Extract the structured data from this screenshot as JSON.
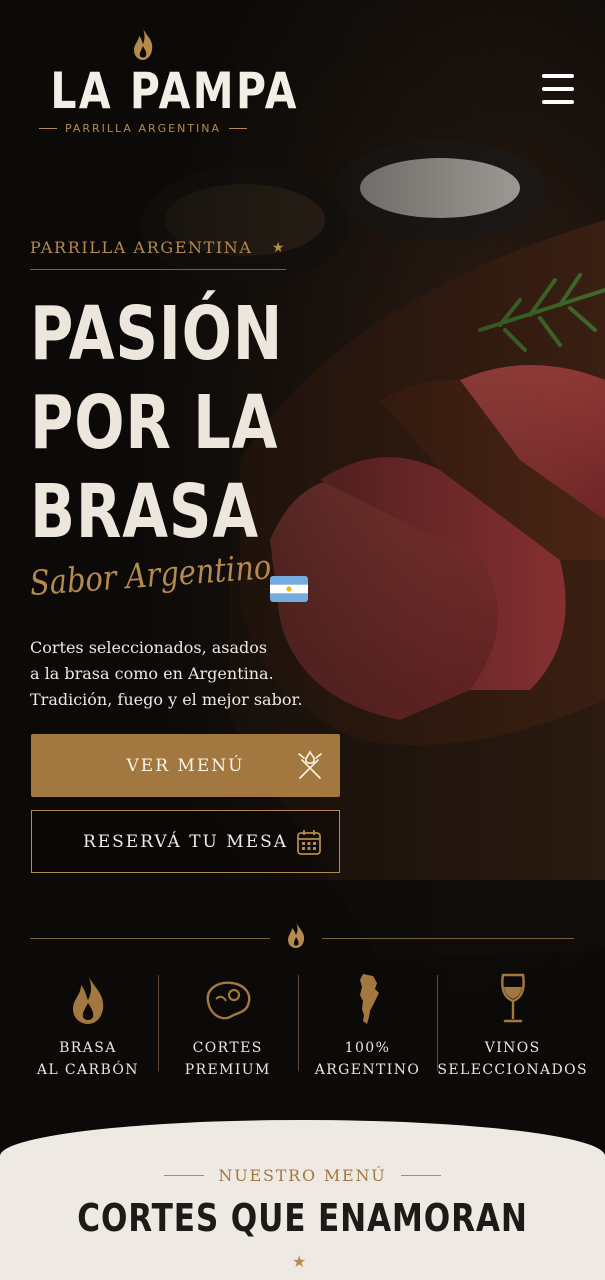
{
  "brand": {
    "name": "LA PAMPA",
    "tagline": "PARRILLA ARGENTINA",
    "accent": "#b58a4e"
  },
  "header": {
    "menu_icon": "hamburger-menu-icon"
  },
  "hero": {
    "eyebrow": "PARRILLA ARGENTINA",
    "title_lines": [
      "PASIÓN",
      "POR LA",
      "BRASA"
    ],
    "script": "Sabor Argentino",
    "description_lines": [
      "Cortes seleccionados, asados",
      "a la brasa como en Argentina.",
      "Tradición, fuego y el mejor sabor."
    ],
    "primary_button": {
      "label": "VER MENÚ",
      "icon": "grill-fork-icon"
    },
    "secondary_button": {
      "label": "RESERVÁ TU MESA",
      "icon": "calendar-icon"
    }
  },
  "features": [
    {
      "icon": "flame-icon",
      "lines": [
        "BRASA",
        "AL CARBÓN"
      ]
    },
    {
      "icon": "steak-icon",
      "lines": [
        "CORTES",
        "PREMIUM"
      ]
    },
    {
      "icon": "argentina-map-icon",
      "lines": [
        "100%",
        "ARGENTINO"
      ]
    },
    {
      "icon": "wine-glass-icon",
      "lines": [
        "VINOS",
        "SELECCIONADOS"
      ]
    }
  ],
  "menu_section": {
    "eyebrow": "NUESTRO MENÚ",
    "title": "CORTES QUE ENAMORAN"
  }
}
